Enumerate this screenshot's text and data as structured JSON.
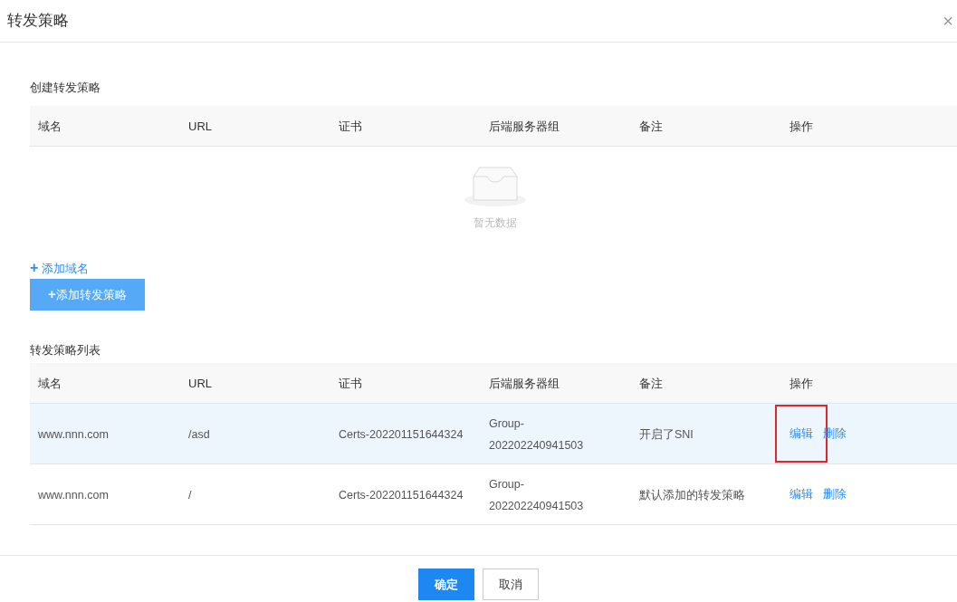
{
  "dialog": {
    "title": "转发策略",
    "close": "×"
  },
  "create_section": {
    "title": "创建转发策略",
    "columns": [
      "域名",
      "URL",
      "证书",
      "后端服务器组",
      "备注",
      "操作"
    ],
    "empty_text": "暂无数据",
    "add_domain_link": "添加域名",
    "add_policy_button": "添加转发策略",
    "plus": "+"
  },
  "list_section": {
    "title": "转发策略列表",
    "columns": [
      "域名",
      "URL",
      "证书",
      "后端服务器组",
      "备注",
      "操作"
    ],
    "rows": [
      {
        "selected": true,
        "cells": [
          "www.nnn.com",
          "/asd",
          "Certs-202201151644324",
          "Group-\n202202240941503",
          "开启了SNI"
        ],
        "actions": [
          {
            "label": "编辑",
            "highlighted": true
          },
          {
            "label": "删除",
            "highlighted": false
          }
        ]
      },
      {
        "selected": false,
        "cells": [
          "www.nnn.com",
          "/",
          "Certs-202201151644324",
          "Group-\n202202240941503",
          "默认添加的转发策略"
        ],
        "actions": [
          {
            "label": "编辑",
            "highlighted": false
          },
          {
            "label": "删除",
            "highlighted": false
          }
        ]
      }
    ]
  },
  "footer": {
    "buttons": [
      {
        "label": "确定",
        "kind": "primary"
      },
      {
        "label": "取消",
        "kind": "default"
      }
    ]
  }
}
